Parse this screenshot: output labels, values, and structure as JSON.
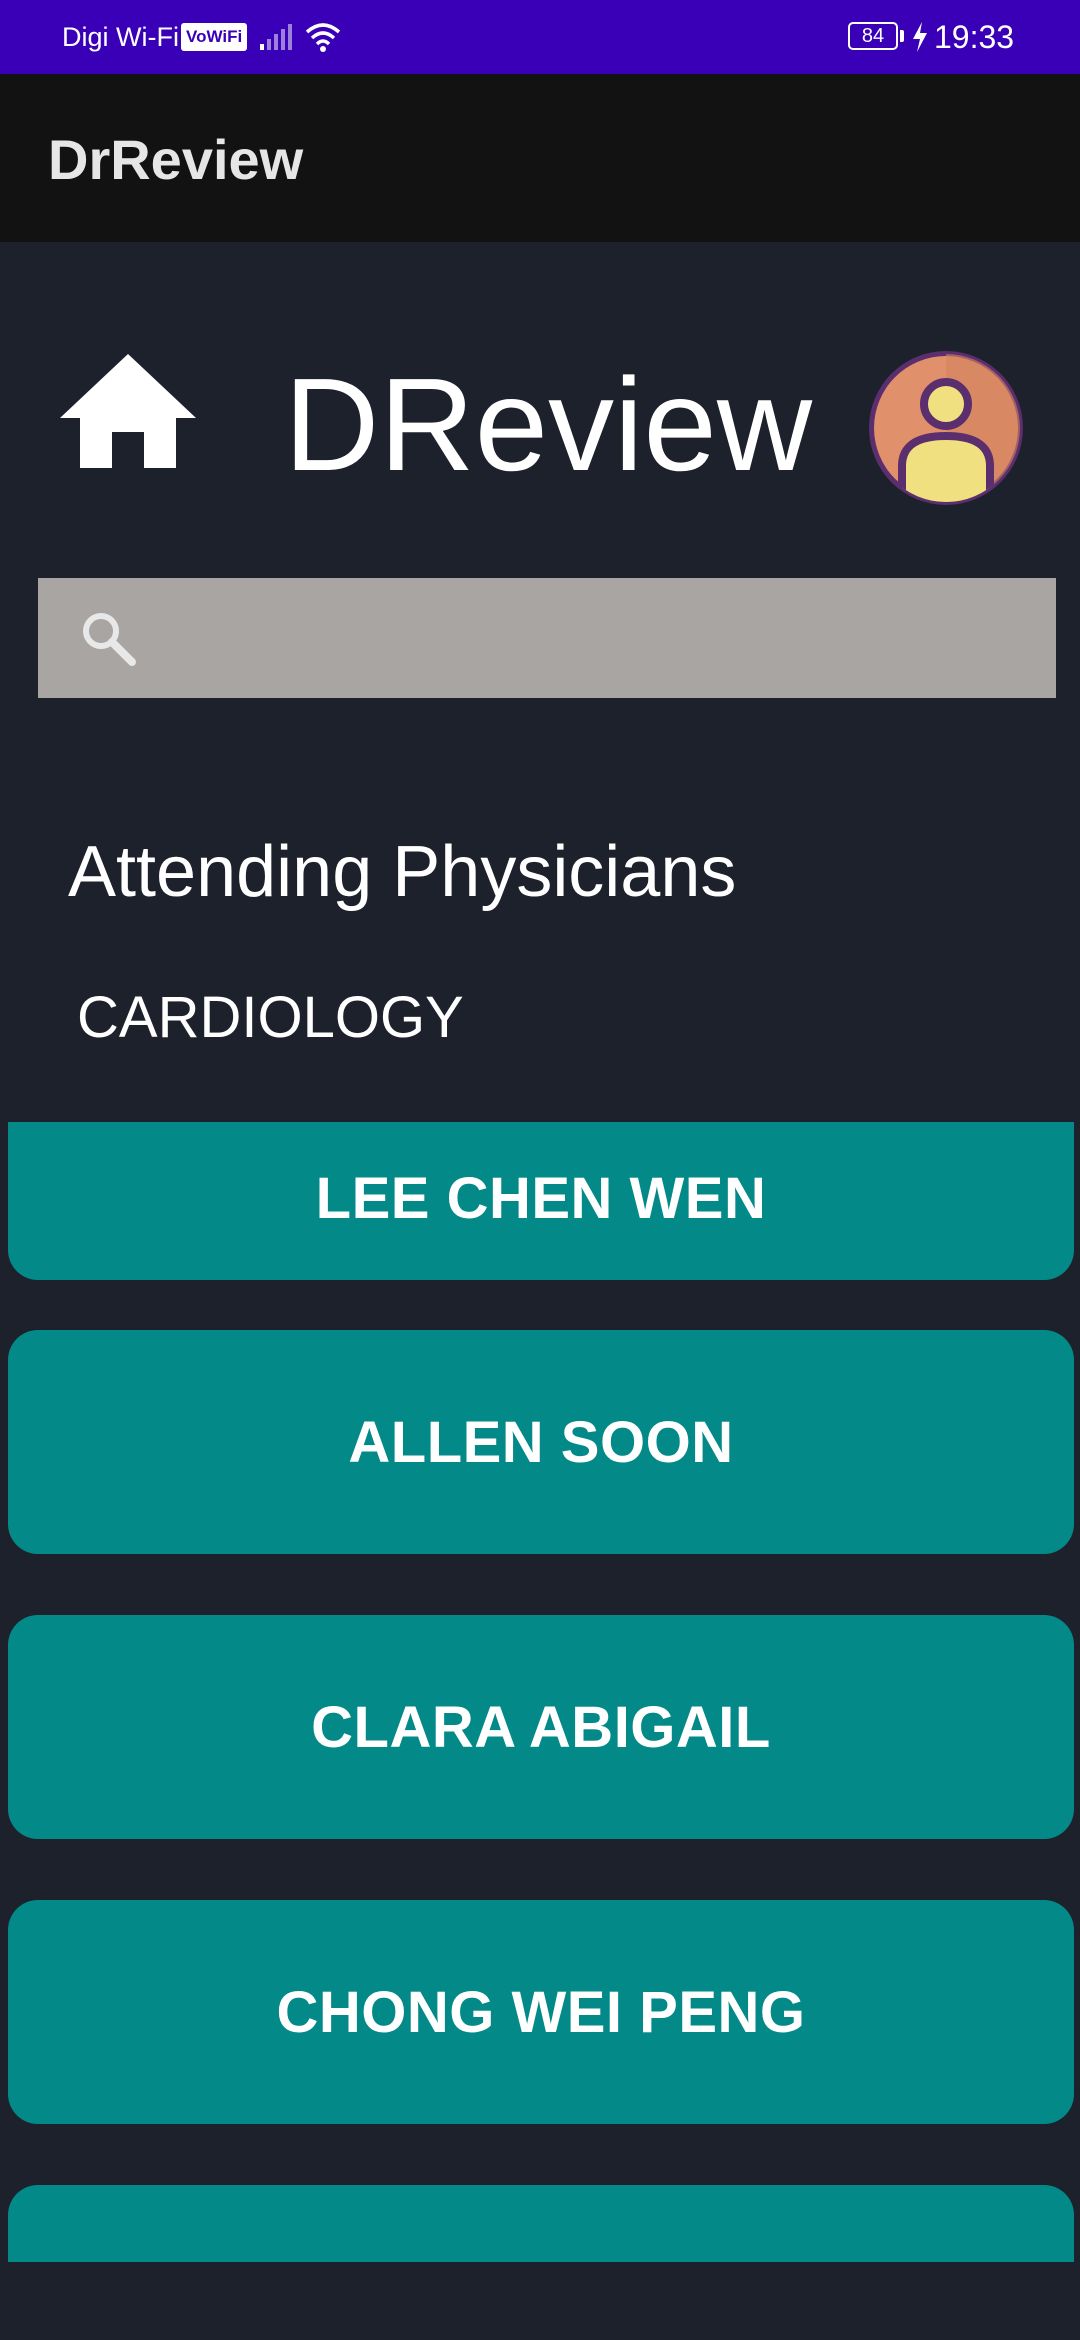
{
  "status_bar": {
    "carrier": "Digi Wi-Fi",
    "vowifi_badge": "VoWiFi",
    "battery_level": "84",
    "time": "19:33",
    "icons": [
      "signal-icon",
      "wifi-icon",
      "battery-icon",
      "charging-bolt-icon"
    ]
  },
  "app_bar": {
    "title": "DrReview"
  },
  "header": {
    "brand": "DReview",
    "home_icon": "home-icon",
    "avatar_icon": "user-avatar-icon"
  },
  "search": {
    "value": "",
    "placeholder": "",
    "icon": "search-icon"
  },
  "section": {
    "title": "Attending Physicians",
    "department": "CARDIOLOGY"
  },
  "doctors": [
    {
      "name": "LEE CHEN WEN"
    },
    {
      "name": "ALLEN SOON"
    },
    {
      "name": "CLARA ABIGAIL"
    },
    {
      "name": "CHONG WEI PENG"
    },
    {
      "name": ""
    }
  ],
  "colors": {
    "status_bar": "#3a00b8",
    "app_bar": "#121212",
    "background": "#1c212b",
    "search_bar": "#a8a5a2",
    "card": "#038a88",
    "avatar_ring": "#5b2e6e",
    "avatar_fill": "#e0906a",
    "avatar_person": "#f0e080"
  }
}
